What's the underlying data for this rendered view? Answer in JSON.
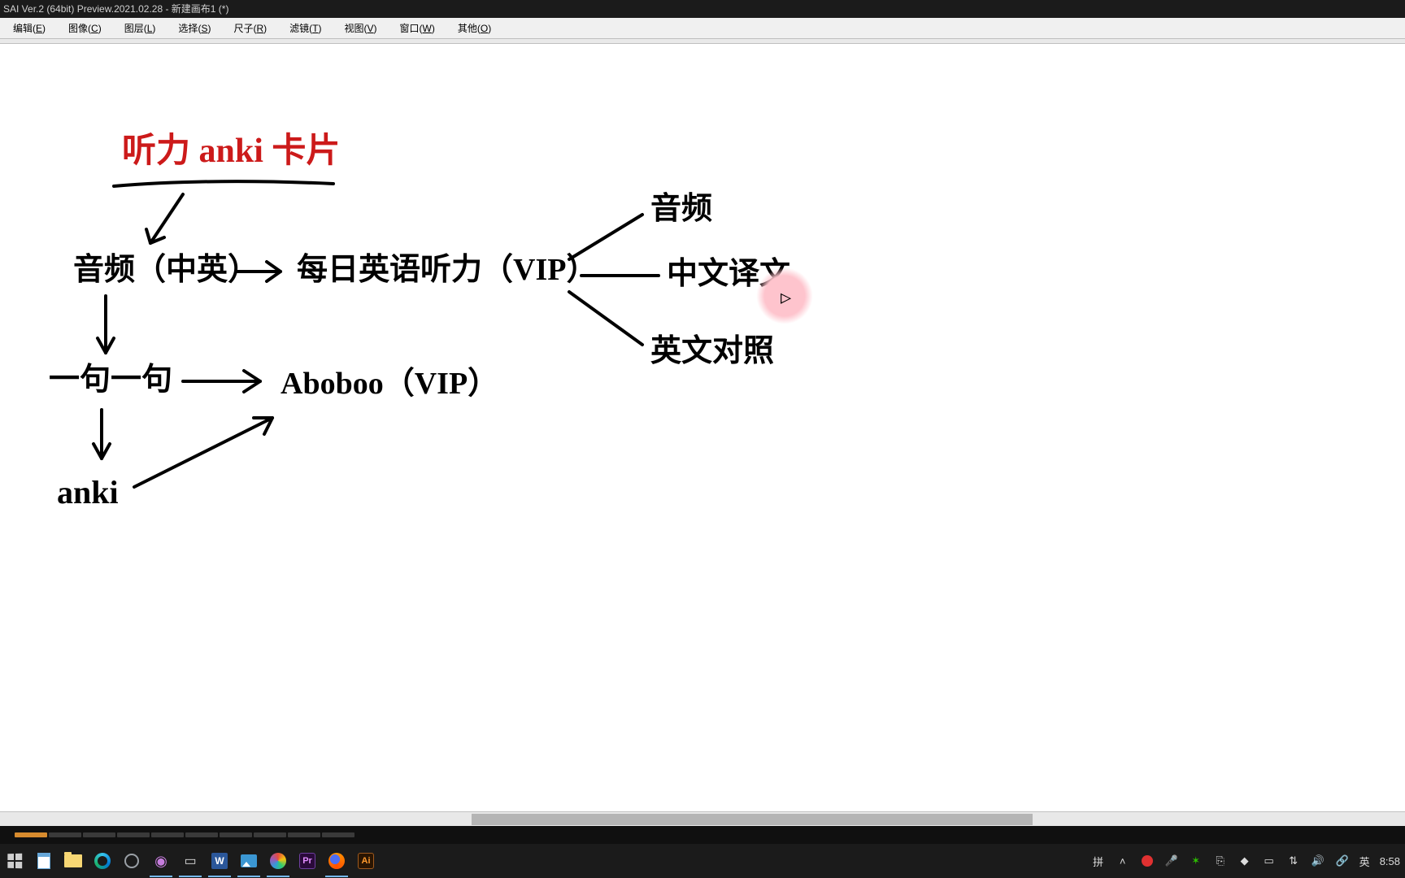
{
  "titlebar": {
    "text": "SAI Ver.2 (64bit) Preview.2021.02.28 - 新建画布1 (*)"
  },
  "menubar": {
    "items": [
      {
        "label": "编辑",
        "hotkey": "E"
      },
      {
        "label": "图像",
        "hotkey": "C"
      },
      {
        "label": "图层",
        "hotkey": "L"
      },
      {
        "label": "选择",
        "hotkey": "S"
      },
      {
        "label": "尺子",
        "hotkey": "R"
      },
      {
        "label": "滤镜",
        "hotkey": "T"
      },
      {
        "label": "视图",
        "hotkey": "V"
      },
      {
        "label": "窗口",
        "hotkey": "W"
      },
      {
        "label": "其他",
        "hotkey": "O"
      }
    ]
  },
  "canvas": {
    "title_text": "听力 anki 卡片",
    "title_color": "#cc1a1a",
    "nodes": {
      "audio_cn_en": "音频（中英）",
      "daily_eng_vip": "每日英语听力（VIP）",
      "audio": "音频",
      "cn_translation": "中文译文",
      "en_compare": "英文对照",
      "sentence": "一句一句",
      "aboboo": "Aboboo（VIP）",
      "anki": "anki"
    }
  },
  "taskbar": {
    "tray": {
      "ime": "拼",
      "lang": "英",
      "clock": "8:58"
    }
  }
}
